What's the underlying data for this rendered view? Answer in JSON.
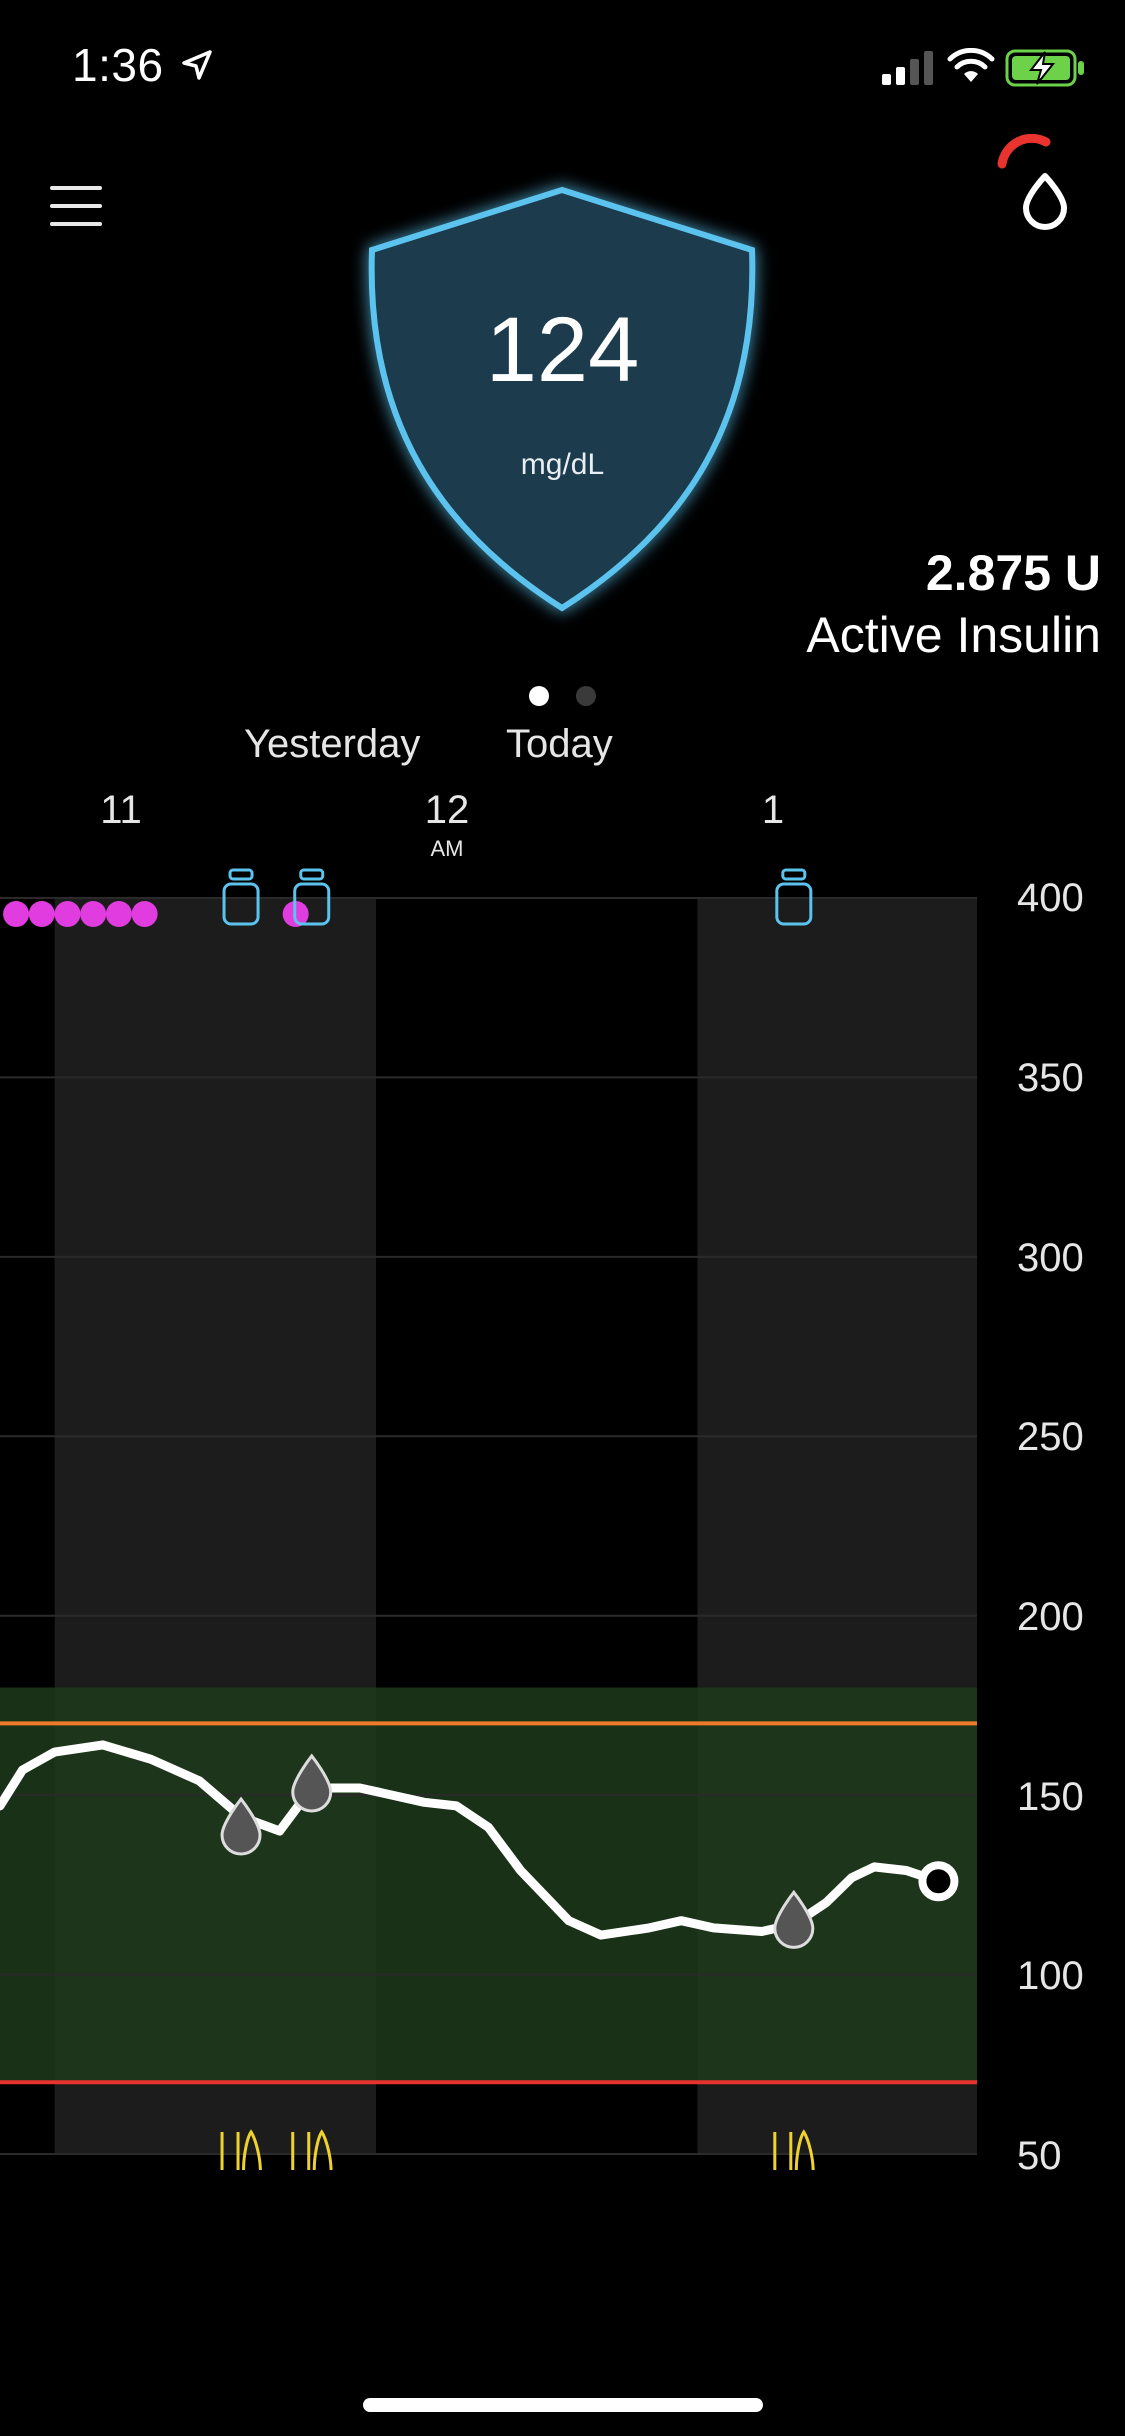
{
  "status_bar": {
    "time": "1:36",
    "signal_icon": "cellular-signal-icon",
    "wifi_icon": "wifi-icon",
    "battery_icon": "battery-charging-icon"
  },
  "header": {
    "menu_icon": "hamburger-menu-icon",
    "pump_status_icon": "insulin-drop-status-icon"
  },
  "glucose": {
    "value": "124",
    "unit": "mg/dL",
    "shield_color": "#5bc3ee"
  },
  "active_insulin": {
    "value": "2.875 U",
    "label": "Active Insulin"
  },
  "page_indicator": {
    "pages": 2,
    "current": 1
  },
  "chart_header": {
    "days": [
      "Yesterday",
      "Today"
    ],
    "hours": [
      {
        "label": "11",
        "sub": ""
      },
      {
        "label": "12",
        "sub": "AM"
      },
      {
        "label": "1",
        "sub": ""
      }
    ]
  },
  "colors": {
    "target_range": "#1d3a1a",
    "high_limit": "#f07a2a",
    "low_limit": "#e8332e",
    "trace": "#ffffff",
    "bolus": "#5bc3ee",
    "meal": "#f0d22e",
    "alerts": "#e03ce0"
  },
  "chart_data": {
    "type": "line",
    "x_range_hours": [
      22.83,
      25.87
    ],
    "ylim": [
      50,
      400
    ],
    "y_ticks": [
      "400",
      "350",
      "300",
      "250",
      "200",
      "150",
      "100",
      "50"
    ],
    "x_ticks": [
      "11",
      "12",
      "1"
    ],
    "target_range": [
      70,
      180
    ],
    "high_line": 170,
    "low_line": 70,
    "series": [
      {
        "x": [
          22.83,
          22.9,
          23.0,
          23.15,
          23.3,
          23.45,
          23.58,
          23.7,
          23.8,
          23.95,
          24.15,
          24.25,
          24.35,
          24.45,
          24.6,
          24.7,
          24.85,
          24.95,
          25.05,
          25.2,
          25.3,
          25.4,
          25.48,
          25.55,
          25.65,
          25.75
        ],
        "y": [
          147,
          157,
          162,
          164,
          160,
          154,
          144,
          140,
          152,
          152,
          148,
          147,
          141,
          129,
          115,
          111,
          113,
          115,
          113,
          112,
          114,
          120,
          127,
          130,
          129,
          126
        ]
      }
    ],
    "current_point": {
      "x": 25.75,
      "y": 126
    },
    "calibrations": [
      {
        "x": 23.58,
        "y": 140
      },
      {
        "x": 23.8,
        "y": 152
      },
      {
        "x": 25.3,
        "y": 114
      }
    ],
    "bolus_events": [
      23.58,
      23.8,
      25.3
    ],
    "meal_events": [
      23.58,
      23.8,
      25.3
    ],
    "alert_events": [
      22.88,
      22.96,
      23.04,
      23.12,
      23.2,
      23.28,
      23.75
    ]
  }
}
